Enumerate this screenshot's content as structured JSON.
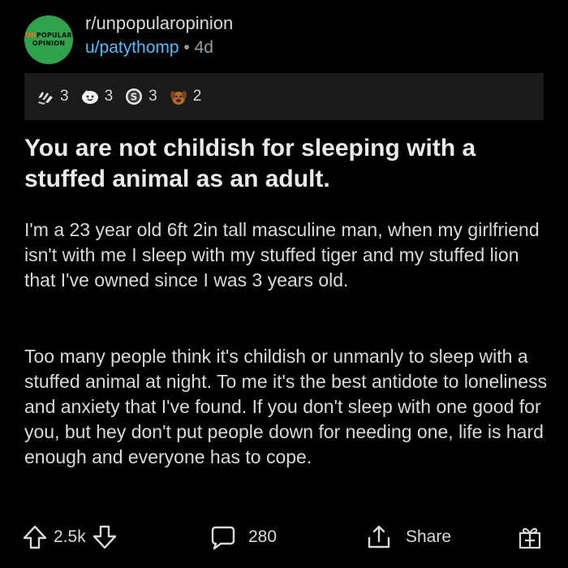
{
  "subreddit": {
    "logo_text_line1_prefix": "UN",
    "logo_text_line1_rest": "POPULAR",
    "logo_text_line2": "OPINION",
    "name": "r/unpopularopinion"
  },
  "post_meta": {
    "author": "u/patythomp",
    "separator": "•",
    "age": "4d"
  },
  "awards": [
    {
      "icon": "hands-award-icon",
      "count": "3"
    },
    {
      "icon": "wholesome-face-award-icon",
      "count": "3"
    },
    {
      "icon": "silver-coin-award-icon",
      "count": "3"
    },
    {
      "icon": "dog-award-icon",
      "count": "2"
    }
  ],
  "post": {
    "title": "You are not childish for sleeping with a stuffed animal as an adult.",
    "paragraphs": [
      "I'm a 23 year old 6ft 2in tall masculine man, when my girlfriend isn't with me I sleep with my stuffed tiger and my stuffed lion that I've owned since I was 3 years old.",
      "Too many people think it's childish or unmanly to sleep with a stuffed animal at night. To me it's the best antidote to loneliness and anxiety that I've found. If you don't sleep with one good for you, but hey don't put people down for needing one, life is hard enough and everyone has to cope."
    ]
  },
  "actions": {
    "score": "2.5k",
    "comments": "280",
    "share_label": "Share"
  },
  "colors": {
    "background": "#000000",
    "text": "#d7dadc",
    "link_blue": "#4fbcff",
    "logo_green": "#2fa24b",
    "awards_bar": "#1a1a1b"
  }
}
